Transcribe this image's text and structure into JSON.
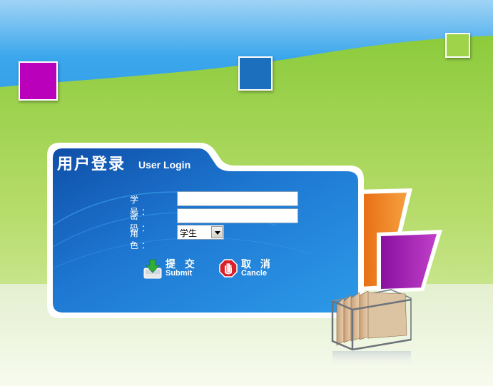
{
  "header": {
    "title_cn": "用户登录",
    "title_en": "User Login"
  },
  "form": {
    "student_id_label": "学　号：",
    "password_label": "密　码：",
    "role_label": "角　色：",
    "student_id_value": "",
    "password_value": "",
    "role_selected": "学生"
  },
  "actions": {
    "submit_cn": "提 交",
    "submit_en": "Submit",
    "cancel_cn": "取 消",
    "cancel_en": "Cancle"
  },
  "colors": {
    "sky_blue": "#1e8fe0",
    "grass_green": "#8cc63f",
    "panel_blue": "#1f7fd6",
    "accent_orange": "#f07a1a",
    "accent_purple": "#a020b0"
  },
  "icons": {
    "submit": "download-arrow-icon",
    "cancel": "stop-hand-icon",
    "file_box": "file-box-icon"
  }
}
